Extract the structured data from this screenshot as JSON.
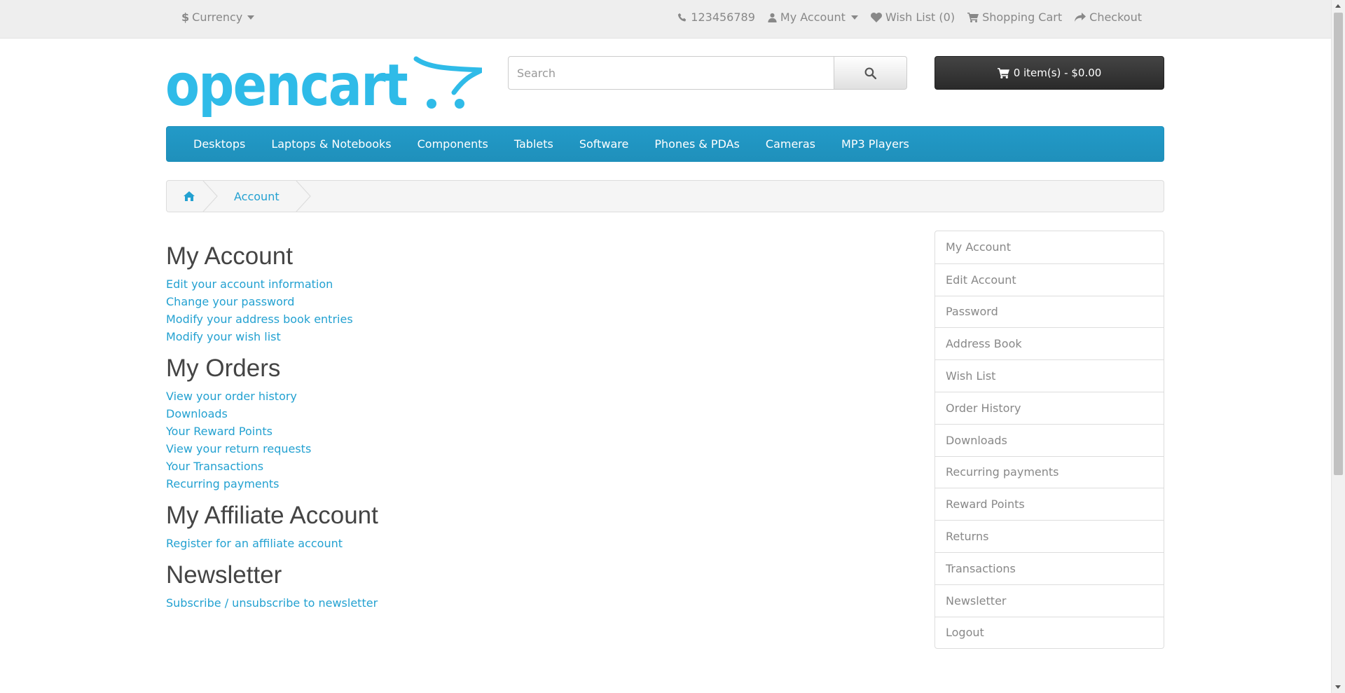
{
  "top_bar": {
    "currency_symbol": "$",
    "currency_label": "Currency",
    "phone": "123456789",
    "my_account": "My Account",
    "wish_list": "Wish List (0)",
    "shopping_cart": "Shopping Cart",
    "checkout": "Checkout"
  },
  "header": {
    "logo_text": "opencart",
    "search_placeholder": "Search",
    "cart_label": "0 item(s) - $0.00"
  },
  "menu": {
    "items": [
      "Desktops",
      "Laptops & Notebooks",
      "Components",
      "Tablets",
      "Software",
      "Phones & PDAs",
      "Cameras",
      "MP3 Players"
    ]
  },
  "breadcrumb": {
    "account": "Account"
  },
  "content": {
    "sections": [
      {
        "heading": "My Account",
        "links": [
          "Edit your account information",
          "Change your password",
          "Modify your address book entries",
          "Modify your wish list"
        ]
      },
      {
        "heading": "My Orders",
        "links": [
          "View your order history",
          "Downloads",
          "Your Reward Points",
          "View your return requests",
          "Your Transactions",
          "Recurring payments"
        ]
      },
      {
        "heading": "My Affiliate Account",
        "links": [
          "Register for an affiliate account"
        ]
      },
      {
        "heading": "Newsletter",
        "links": [
          "Subscribe / unsubscribe to newsletter"
        ]
      }
    ]
  },
  "sidebar": {
    "items": [
      "My Account",
      "Edit Account",
      "Password",
      "Address Book",
      "Wish List",
      "Order History",
      "Downloads",
      "Recurring payments",
      "Reward Points",
      "Returns",
      "Transactions",
      "Newsletter",
      "Logout"
    ]
  },
  "colors": {
    "brand_blue": "#23a1d1",
    "menu_blue": "#229ac8",
    "logo_blue": "#2fbbe8"
  }
}
